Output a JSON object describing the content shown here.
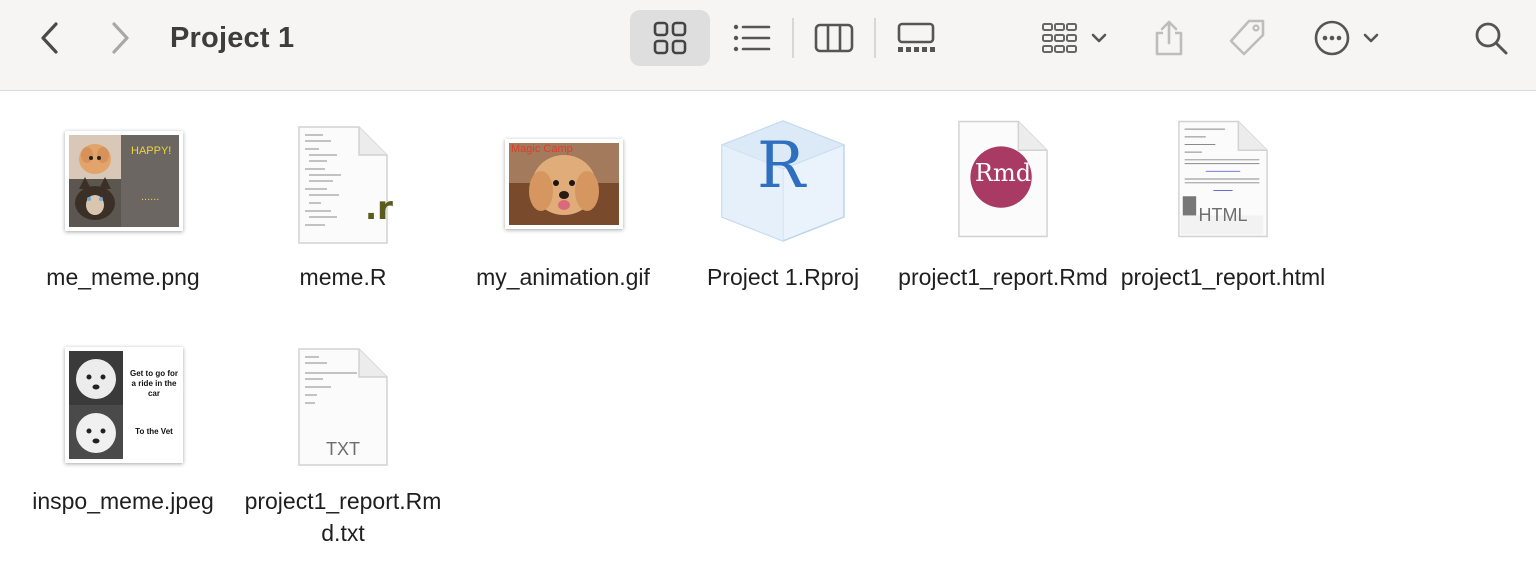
{
  "window": {
    "title": "Project 1"
  },
  "toolbar": {
    "back_icon": "chevron-left-icon",
    "forward_icon": "chevron-right-icon",
    "view_modes": [
      "icon-view-icon",
      "list-view-icon",
      "column-view-icon",
      "gallery-view-icon"
    ],
    "selected_view": "icon-view-icon",
    "group_icon": "group-grid-icon",
    "share_icon": "share-icon",
    "tag_icon": "tag-icon",
    "more_icon": "ellipsis-circle-icon",
    "search_icon": "search-icon"
  },
  "files": [
    {
      "name": "me_meme.png",
      "kind": "image-png"
    },
    {
      "name": "meme.R",
      "kind": "r-script",
      "badge": ".r"
    },
    {
      "name": "my_animation.gif",
      "kind": "image-gif",
      "overlay_text": "Magic Camp"
    },
    {
      "name": "Project 1.Rproj",
      "kind": "rproj",
      "badge": "R"
    },
    {
      "name": "project1_report.Rmd",
      "kind": "rmd",
      "badge": "Rmd"
    },
    {
      "name": "project1_report.html",
      "kind": "html",
      "badge": "HTML"
    },
    {
      "name": "inspo_meme.jpeg",
      "kind": "image-jpeg",
      "captions": [
        "Get to go for a ride in the car",
        "To the Vet"
      ]
    },
    {
      "name": "project1_report.Rmd.txt",
      "kind": "txt",
      "badge": "TXT"
    }
  ],
  "thumb_text": {
    "me_meme_happy": "HAPPY!",
    "me_meme_dots": "......"
  },
  "colors": {
    "toolbar_bg": "#f6f5f4",
    "selected_segment": "#dedede",
    "rmd_badge": "#a83a64",
    "rproj_blue": "#2f6fc0"
  }
}
